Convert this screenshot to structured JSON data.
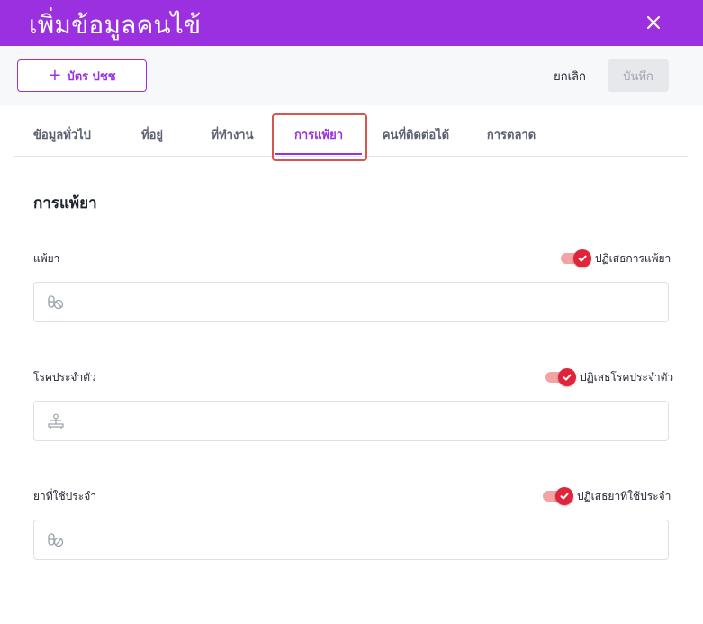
{
  "header": {
    "title": "เพิ่มข้อมูลคนไข้",
    "close_icon": "close-icon"
  },
  "toolbar": {
    "add_card_label": "บัตร ปชช",
    "add_icon": "+",
    "cancel_label": "ยกเลิก",
    "save_label": "บันทึก"
  },
  "tabs": [
    {
      "label": "ข้อมูลทั่วไป",
      "active": false
    },
    {
      "label": "ที่อยู่",
      "active": false
    },
    {
      "label": "ที่ทำงาน",
      "active": false
    },
    {
      "label": "การแพ้ยา",
      "active": true
    },
    {
      "label": "คนที่ติดต่อได้",
      "active": false
    },
    {
      "label": "การตลาด",
      "active": false
    }
  ],
  "section": {
    "title": "การแพ้ยา"
  },
  "fields": [
    {
      "label": "แพ้ยา",
      "toggle_label": "ปฏิเสธการแพ้ยา",
      "toggle_on": true,
      "icon": "pill-blocked-icon",
      "value": ""
    },
    {
      "label": "โรคประจำตัว",
      "toggle_label": "ปฏิเสธโรคประจำตัว",
      "toggle_on": true,
      "icon": "patient-icon",
      "value": ""
    },
    {
      "label": "ยาที่ใช้ประจำ",
      "toggle_label": "ปฏิเสธยาที่ใช้ประจำ",
      "toggle_on": true,
      "icon": "pills-icon",
      "value": ""
    }
  ],
  "colors": {
    "brand": "#9b30e0",
    "toggle_on": "#e0243a",
    "highlight": "#d9534f"
  }
}
